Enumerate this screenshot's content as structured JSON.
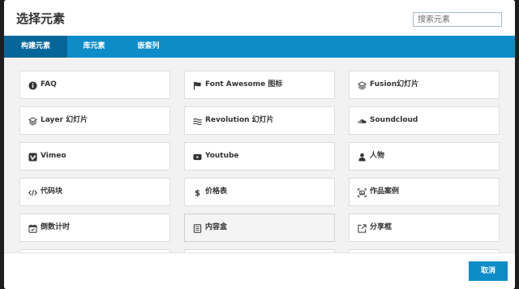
{
  "dialog": {
    "title": "选择元素",
    "search": {
      "placeholder": "搜索元素",
      "value": ""
    }
  },
  "tabs": [
    {
      "label": "构建元素",
      "active": true
    },
    {
      "label": "库元素",
      "active": false
    },
    {
      "label": "嵌套列",
      "active": false
    }
  ],
  "elements": [
    {
      "label": "FAQ",
      "icon": "info-circle-icon"
    },
    {
      "label": "Font Awesome 图标",
      "icon": "flag-icon"
    },
    {
      "label": "Fusion幻灯片",
      "icon": "layers-icon"
    },
    {
      "label": "Layer 幻灯片",
      "icon": "layers-icon"
    },
    {
      "label": "Revolution 幻灯片",
      "icon": "waves-icon"
    },
    {
      "label": "Soundcloud",
      "icon": "soundcloud-icon"
    },
    {
      "label": "Vimeo",
      "icon": "vimeo-icon"
    },
    {
      "label": "Youtube",
      "icon": "youtube-icon"
    },
    {
      "label": "人物",
      "icon": "person-icon"
    },
    {
      "label": "代码块",
      "icon": "code-icon"
    },
    {
      "label": "价格表",
      "icon": "dollar-icon"
    },
    {
      "label": "作品案例",
      "icon": "portfolio-icon"
    },
    {
      "label": "倒数计时",
      "icon": "calendar-icon"
    },
    {
      "label": "内容盒",
      "icon": "content-box-icon",
      "highlighted": true
    },
    {
      "label": "分享框",
      "icon": "share-icon"
    }
  ],
  "footer": {
    "cancel_label": "取消"
  },
  "colors": {
    "accent": "#0d8cc8",
    "active_tab": "#06669a",
    "grid_bg": "#f2f2f2"
  }
}
